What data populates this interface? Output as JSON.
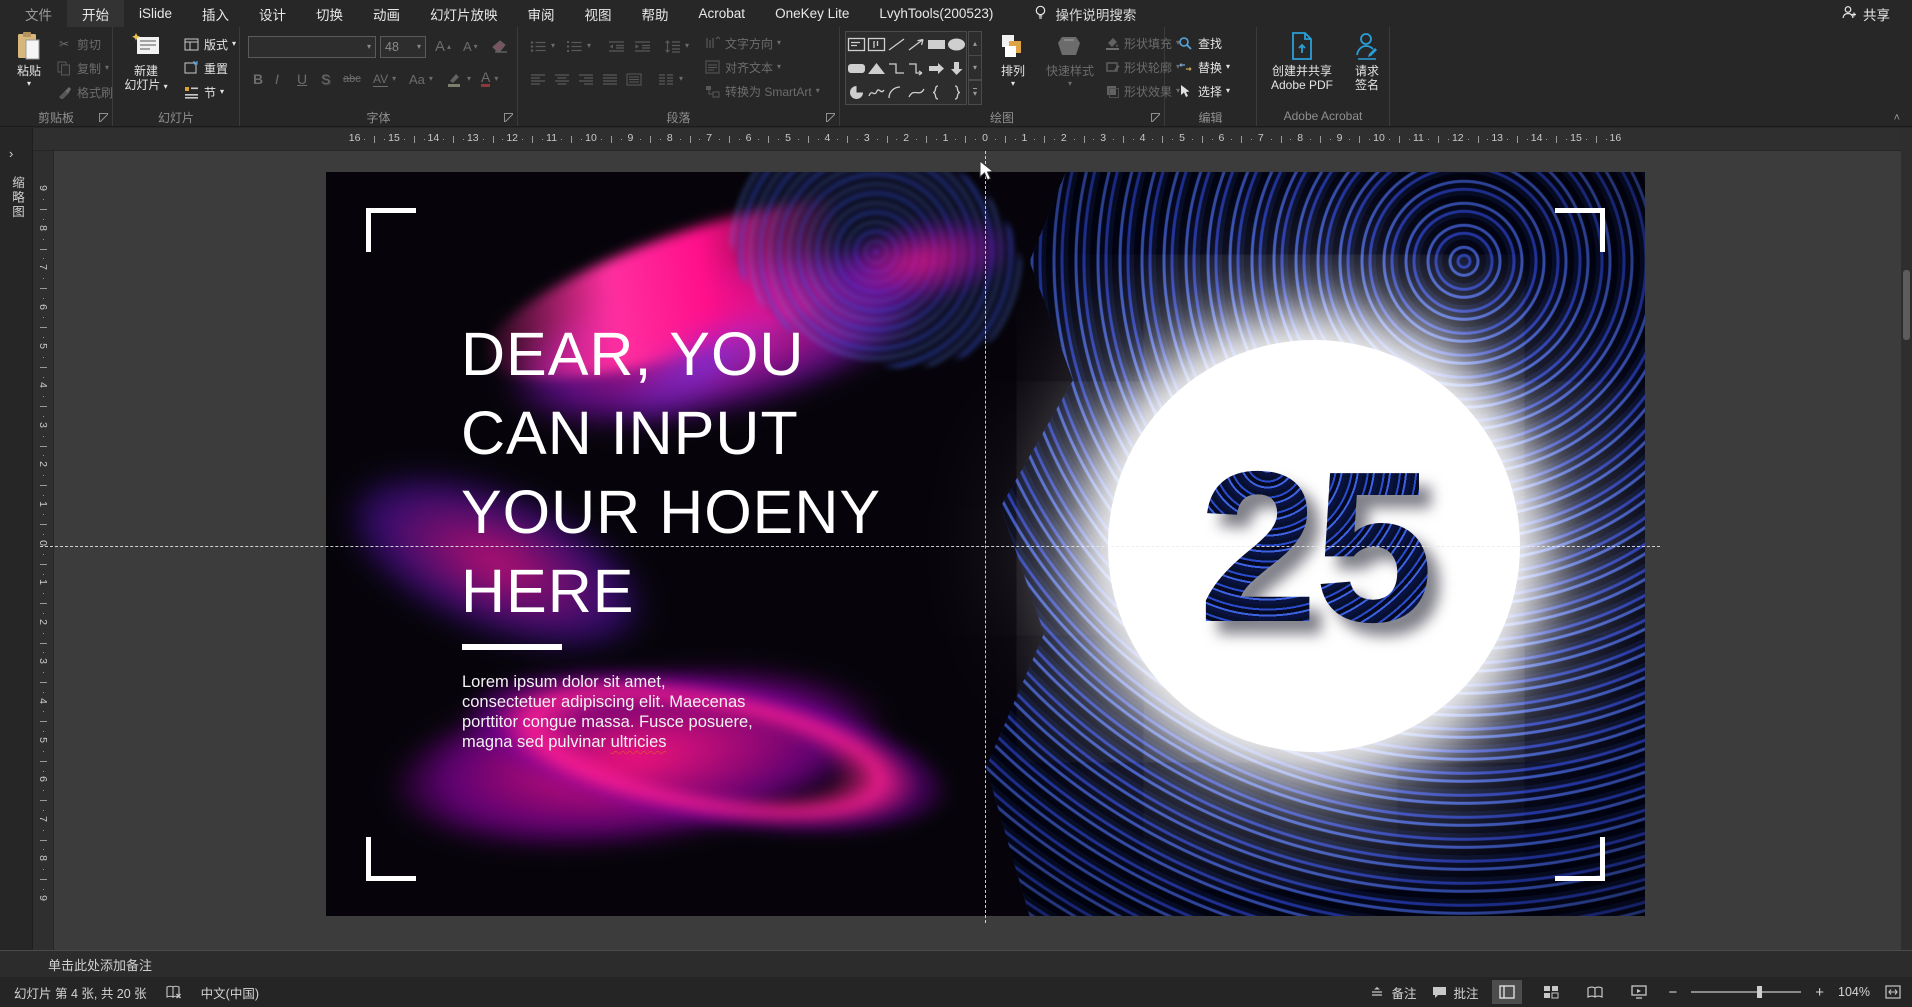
{
  "icons": {
    "dropdown": "▾",
    "up": "▴",
    "chevron_right": "›",
    "scissors": "✂",
    "collapse": "˄",
    "plus": "+",
    "minus": "−"
  },
  "menu": {
    "items": [
      "文件",
      "开始",
      "iSlide",
      "插入",
      "设计",
      "切换",
      "动画",
      "幻灯片放映",
      "审阅",
      "视图",
      "帮助",
      "Acrobat",
      "OneKey Lite",
      "LvyhTools(200523)"
    ],
    "search_label": "操作说明搜索",
    "share_label": "共享"
  },
  "ribbon": {
    "clipboard": {
      "title": "剪贴板",
      "paste": "粘贴",
      "cut": "剪切",
      "copy": "复制",
      "painter": "格式刷"
    },
    "slides": {
      "title": "幻灯片",
      "new_slide_l1": "新建",
      "new_slide_l2": "幻灯片",
      "layout": "版式",
      "reset": "重置",
      "section": "节"
    },
    "font": {
      "title": "字体",
      "size_value": "48",
      "bold": "B",
      "italic": "I",
      "underline": "U",
      "shadow": "S",
      "strike": "abc",
      "spacing": "AV",
      "case_toggle": "Aa",
      "color_letter": "A"
    },
    "paragraph": {
      "title": "段落",
      "text_direction": "文字方向",
      "align_text": "对齐文本",
      "smartart": "转换为 SmartArt"
    },
    "drawing": {
      "title": "绘图",
      "arrange": "排列",
      "quick_styles": "快速样式",
      "fill": "形状填充",
      "outline": "形状轮廓",
      "effects": "形状效果",
      "shapes": [
        "text-box",
        "vertical-text-box",
        "line",
        "arrow",
        "rectangle",
        "oval",
        "rounded-rectangle",
        "triangle",
        "elbow-connector",
        "elbow-arrow-connector",
        "right-arrow",
        "down-arrow",
        "pie",
        "scribble",
        "arc",
        "curve",
        "left-brace",
        "right-brace"
      ]
    },
    "editing": {
      "title": "编辑",
      "find": "查找",
      "replace": "替换",
      "select": "选择"
    },
    "acrobat": {
      "title": "Adobe Acrobat",
      "create_l1": "创建并共享",
      "create_l2": "Adobe PDF",
      "sign_l1": "请求",
      "sign_l2": "签名"
    }
  },
  "panels": {
    "thumbnails_tab": "缩略图"
  },
  "ruler": {
    "h": [
      "16",
      "15",
      "14",
      "13",
      "12",
      "11",
      "10",
      "9",
      "8",
      "7",
      "6",
      "5",
      "4",
      "3",
      "2",
      "1",
      "0",
      "1",
      "2",
      "3",
      "4",
      "5",
      "6",
      "7",
      "8",
      "9",
      "10",
      "11",
      "12",
      "13",
      "14",
      "15",
      "16"
    ],
    "v": [
      "9",
      "8",
      "7",
      "6",
      "5",
      "4",
      "3",
      "2",
      "1",
      "0",
      "1",
      "2",
      "3",
      "4",
      "5",
      "6",
      "7",
      "8",
      "9"
    ]
  },
  "slide": {
    "heading": [
      "DEAR, YOU",
      "CAN INPUT",
      "YOUR HOENY",
      "HERE"
    ],
    "body": [
      "Lorem ipsum dolor sit amet,",
      "consectetuer adipiscing elit. Maecenas",
      "porttitor congue massa. Fusce posuere,",
      "magna sed pulvinar "
    ],
    "body_misspelled": "ultricies",
    "number": "25"
  },
  "notes": {
    "placeholder": "单击此处添加备注"
  },
  "statusbar": {
    "slide_info": "幻灯片 第 4 张, 共 20 张",
    "language": "中文(中国)",
    "notes_btn": "备注",
    "comments_btn": "批注",
    "zoom_percent": "104%"
  }
}
